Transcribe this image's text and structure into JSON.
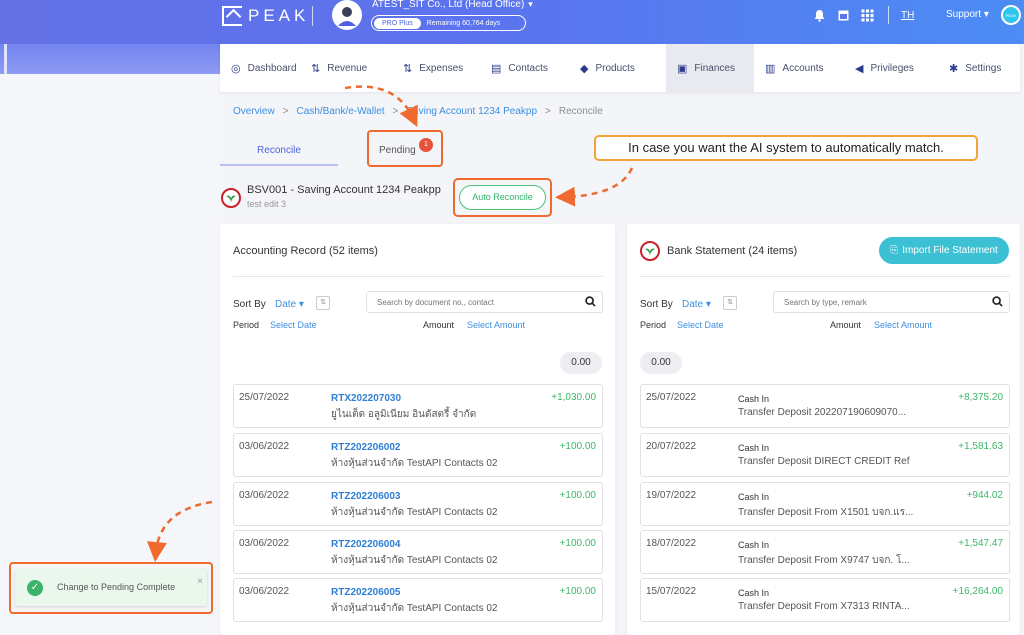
{
  "header": {
    "logo_text": "PEAK",
    "company_name": "ATEST_SIT Co., Ltd (Head Office)",
    "plan_badge": "PRO Plus",
    "plan_remaining": "Remaining 60,764 days",
    "language": "TH",
    "support_label": "Support",
    "user_initials": "PEAK"
  },
  "nav": {
    "items": [
      {
        "label": "Dashboard",
        "icon": "dashboard-icon"
      },
      {
        "label": "Revenue",
        "icon": "revenue-icon"
      },
      {
        "label": "Expenses",
        "icon": "expenses-icon"
      },
      {
        "label": "Contacts",
        "icon": "contacts-icon"
      },
      {
        "label": "Products",
        "icon": "products-icon"
      },
      {
        "label": "Finances",
        "icon": "finances-icon",
        "active": true
      },
      {
        "label": "Accounts",
        "icon": "accounts-icon"
      },
      {
        "label": "Privileges",
        "icon": "privileges-icon"
      },
      {
        "label": "Settings",
        "icon": "settings-icon"
      }
    ]
  },
  "breadcrumb": {
    "items": [
      "Overview",
      "Cash/Bank/e-Wallet",
      "Saving Account 1234 Peakpp"
    ],
    "current": "Reconcile"
  },
  "tabs": {
    "reconcile": "Reconcile",
    "pending": "Pending",
    "pending_count": "1"
  },
  "callout": "In case you want the AI system to automatically match.",
  "account": {
    "title": "BSV001 - Saving Account 1234 Peakpp",
    "subtitle": "test edit 3",
    "auto_reconcile_label": "Auto Reconcile"
  },
  "accounting": {
    "title": "Accounting Record (52 items)",
    "sort_label": "Sort By",
    "sort_value": "Date",
    "search_placeholder": "Search by document no., contact",
    "period_label": "Period",
    "period_value": "Select Date",
    "amount_label": "Amount",
    "amount_value": "Select Amount",
    "total": "0.00",
    "rows": [
      {
        "date": "25/07/2022",
        "doc": "RTX202207030",
        "desc": "ยูไนเต็ด อลูมิเนียม อินดัสตรี้ จำกัด",
        "amount": "+1,030.00"
      },
      {
        "date": "03/06/2022",
        "doc": "RTZ202206002",
        "desc": "ห้างหุ้นส่วนจำกัด TestAPI Contacts 02",
        "amount": "+100.00"
      },
      {
        "date": "03/06/2022",
        "doc": "RTZ202206003",
        "desc": "ห้างหุ้นส่วนจำกัด TestAPI Contacts 02",
        "amount": "+100.00"
      },
      {
        "date": "03/06/2022",
        "doc": "RTZ202206004",
        "desc": "ห้างหุ้นส่วนจำกัด TestAPI Contacts 02",
        "amount": "+100.00"
      },
      {
        "date": "03/06/2022",
        "doc": "RTZ202206005",
        "desc": "ห้างหุ้นส่วนจำกัด TestAPI Contacts 02",
        "amount": "+100.00"
      }
    ]
  },
  "bank": {
    "title": "Bank Statement (24 items)",
    "import_label": "Import File Statement",
    "sort_label": "Sort By",
    "sort_value": "Date",
    "search_placeholder": "Search by type, remark",
    "period_label": "Period",
    "period_value": "Select Date",
    "amount_label": "Amount",
    "amount_value": "Select Amount",
    "total": "0.00",
    "rows": [
      {
        "date": "25/07/2022",
        "type": "Cash In",
        "desc": "Transfer Deposit 202207190609070...",
        "amount": "+8,375.20"
      },
      {
        "date": "20/07/2022",
        "type": "Cash In",
        "desc": "Transfer Deposit DIRECT CREDIT Ref",
        "amount": "+1,581.63"
      },
      {
        "date": "19/07/2022",
        "type": "Cash In",
        "desc": "Transfer Deposit From X1501 บจก.แร...",
        "amount": "+944.02"
      },
      {
        "date": "18/07/2022",
        "type": "Cash In",
        "desc": "Transfer Deposit From X9747 บจก. โ...",
        "amount": "+1,547.47"
      },
      {
        "date": "15/07/2022",
        "type": "Cash In",
        "desc": "Transfer Deposit From X7313 RINTA...",
        "amount": "+16,264.00"
      }
    ]
  },
  "toast": {
    "message": "Change to Pending Complete",
    "close": "×"
  },
  "colors": {
    "brand": "#5c72ee",
    "link": "#3d8fe0",
    "positive": "#3db86a",
    "highlight": "#ee6a2e"
  }
}
